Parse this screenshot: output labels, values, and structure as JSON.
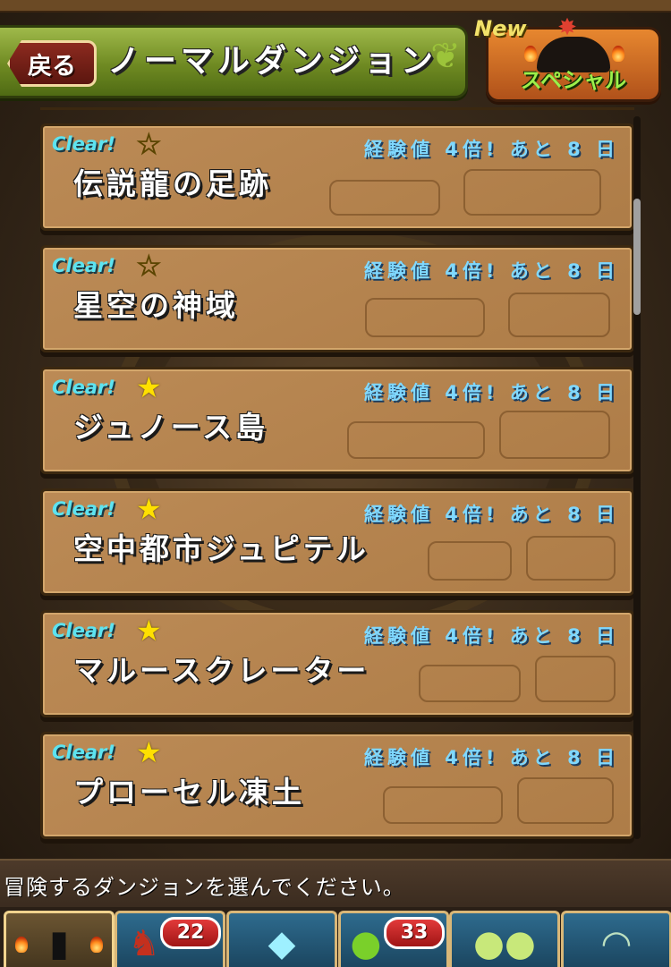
{
  "header": {
    "back_label": "戻る",
    "title": "ノーマルダンジョン",
    "special_label": "スペシャル",
    "new_badge": "New"
  },
  "dungeons": [
    {
      "name": "伝説龍の足跡",
      "clear": "Clear!",
      "star": "hollow",
      "event": "経験値 4倍! あと 8 日"
    },
    {
      "name": "星空の神域",
      "clear": "Clear!",
      "star": "hollow",
      "event": "経験値 4倍! あと 8 日"
    },
    {
      "name": "ジュノース島",
      "clear": "Clear!",
      "star": "filled",
      "event": "経験値 4倍! あと 8 日"
    },
    {
      "name": "空中都市ジュピテル",
      "clear": "Clear!",
      "star": "filled",
      "event": "経験値 4倍! あと 8 日"
    },
    {
      "name": "マルースクレーター",
      "clear": "Clear!",
      "star": "filled",
      "event": "経験値 4倍! あと 8 日"
    },
    {
      "name": "プローセル凍土",
      "clear": "Clear!",
      "star": "filled",
      "event": "経験値 4倍! あと 8 日"
    }
  ],
  "info_message": "冒険するダンジョンを選んでください。",
  "nav": [
    {
      "name": "dungeon",
      "icon": "gate-icon"
    },
    {
      "name": "monsters",
      "icon": "dragon-icon",
      "badge": "22"
    },
    {
      "name": "shop",
      "icon": "gem-icon"
    },
    {
      "name": "egg",
      "icon": "egg-icon",
      "badge": "33"
    },
    {
      "name": "friends",
      "icon": "friends-icon"
    },
    {
      "name": "other",
      "icon": "scroll-icon"
    }
  ],
  "colors": {
    "header_green": "#6f8a22",
    "row_brown": "#b7834b",
    "clear_cyan": "#5de3f0",
    "event_blue": "#7fd8ff",
    "star_yellow": "#ffe000",
    "badge_red": "#e23a3a"
  }
}
